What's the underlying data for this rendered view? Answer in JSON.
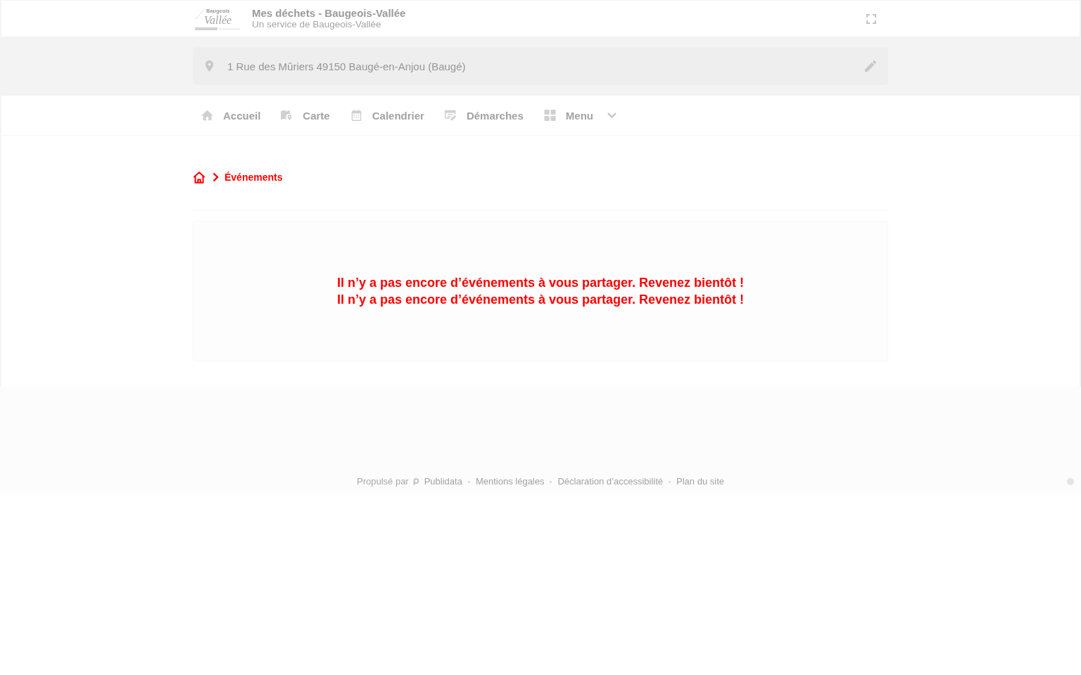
{
  "header": {
    "logo": {
      "wordmark": "Baugeois",
      "script": "Vallée"
    },
    "title": "Mes déchets - Baugeois-Vallée",
    "subtitle": "Un service de Baugeois-Vallée"
  },
  "address_bar": {
    "value": "1 Rue des Mûriers 49150 Baugé-en-Anjou (Baugé)"
  },
  "nav": {
    "items": [
      {
        "label": "Accueil",
        "kind": "link"
      },
      {
        "label": "Carte",
        "kind": "link"
      },
      {
        "label": "Calendrier",
        "kind": "link"
      },
      {
        "label": "Démarches",
        "kind": "link"
      },
      {
        "label": "Menu",
        "kind": "dropdown"
      }
    ]
  },
  "breadcrumb": {
    "current": "Événements"
  },
  "empty_state": {
    "lines": [
      "Il n’y a pas encore d’événements à vous partager. Revenez bientôt !",
      "Il n’y a pas encore d’événements à vous partager. Revenez bientôt !"
    ]
  },
  "footer": {
    "powered_by": {
      "label": "Propulsé par",
      "brand": "Publidata"
    },
    "links": [
      "Mentions légales",
      "Déclaration d’accessibilité",
      "Plan du site"
    ]
  }
}
